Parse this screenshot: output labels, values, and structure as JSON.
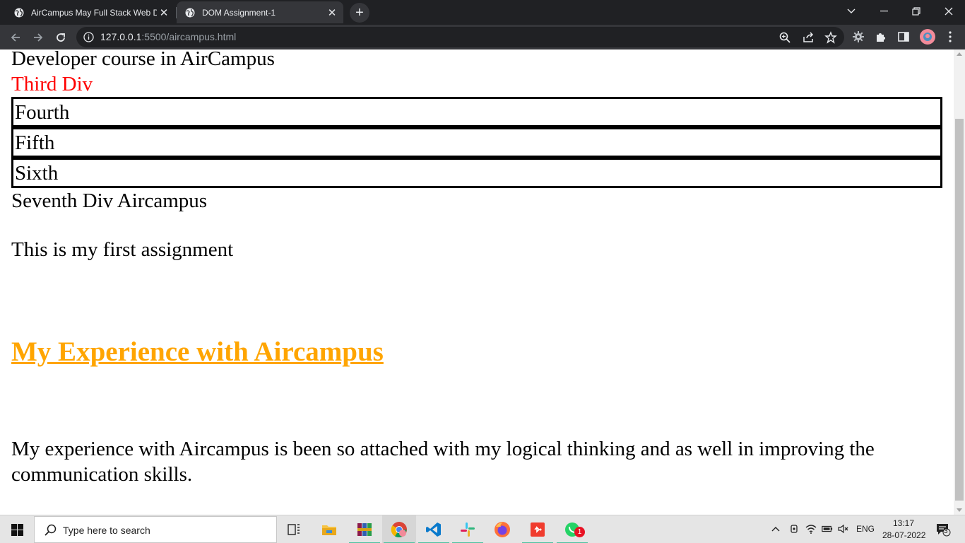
{
  "browser": {
    "tabs": [
      {
        "title": "AirCampus May Full Stack Web D",
        "active": false
      },
      {
        "title": "DOM Assignment-1",
        "active": true
      }
    ],
    "new_tab_symbol": "+",
    "address": {
      "host": "127.0.0.1",
      "path": ":5500/aircampus.html"
    },
    "icons": [
      "back-icon",
      "forward-icon",
      "reload-icon",
      "info-icon",
      "zoom-icon",
      "share-icon",
      "bookmark-star-icon",
      "extension-gear-icon",
      "puzzle-icon",
      "sidepanel-icon",
      "profile-avatar",
      "menu-icon"
    ]
  },
  "page": {
    "line1": "Developer course in AirCampus",
    "third": "Third Div",
    "fourth": "Fourth",
    "fifth": "Fifth",
    "sixth": "Sixth",
    "seventh": "Seventh Div Aircampus",
    "first_assignment": "This is my first assignment",
    "heading": "My Experience with Aircampus",
    "paragraph": "My experience with Aircampus is been so attached with my logical thinking and as well in improving the communication skills.",
    "colors": {
      "red_text": "#ff0000",
      "heading": "#ffa500",
      "box_border": "#000000"
    }
  },
  "taskbar": {
    "search_placeholder": "Type here to search",
    "whatsapp_badge": "1",
    "language": "ENG",
    "time": "13:17",
    "date": "28-07-2022",
    "notification_count": "3",
    "apps": [
      "task-view-icon",
      "file-explorer-icon",
      "winrar-icon",
      "chrome-icon",
      "vscode-icon",
      "slack-icon",
      "firefox-icon",
      "git-icon",
      "whatsapp-icon"
    ]
  }
}
